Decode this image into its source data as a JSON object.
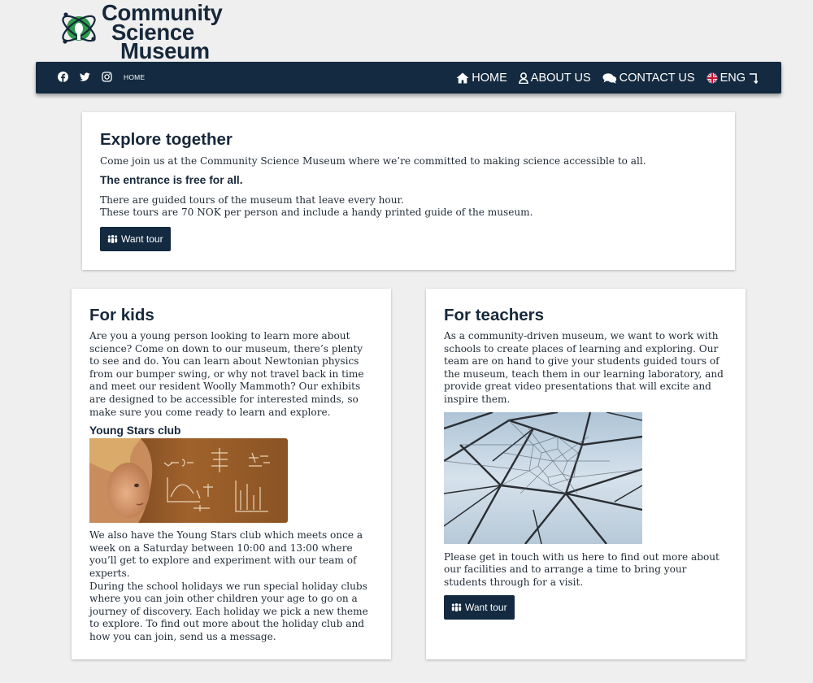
{
  "logo": {
    "line1": "Community",
    "line2": "Science",
    "line3": "Museum"
  },
  "navbar": {
    "social": [
      "facebook-icon",
      "twitter-icon",
      "instagram-icon"
    ],
    "small_home": "HOME",
    "menu": {
      "home": "HOME",
      "about": "ABOUT US",
      "contact": "CONTACT US",
      "lang": "ENG"
    }
  },
  "explore": {
    "title": "Explore together",
    "intro": "Come join us at the Community Science Museum where we’re committed to making science accessible to all.",
    "subtitle": "The entrance is free for all.",
    "tours_line1": "There are guided tours of the museum that leave every hour.",
    "tours_line2": "These tours are 70 NOK per person and include a handy printed guide of the museum.",
    "button": "Want tour"
  },
  "kids": {
    "title": "For kids",
    "body": "Are you a young person looking to learn more about science? Come on down to our museum, there’s plenty to see and do. You can learn about Newtonian physics from our bumper swing, or why not travel back in time and meet our resident Woolly Mammoth? Our exhibits are designed to be accessible for interested minds, so make sure you come ready to learn and explore.",
    "club_title": "Young Stars club",
    "club_body1": "We also have the Young Stars club which meets once a week on a Saturday between 10:00 and 13:00 where you’ll get to explore and experiment with our team of experts.",
    "club_body2": "During the school holidays we run special holiday clubs where you can join other children your age to go on a journey of discovery. Each holiday we pick a new theme to explore. To find out more about the holiday club and how you can join, send us a message."
  },
  "teachers": {
    "title": "For teachers",
    "body": "As a community-driven museum, we want to work with schools to create places of learning and exploring. Our team are on hand to give your students guided tours of the museum, teach them in our learning laboratory, and provide great video presentations that will excite and inspire them.",
    "contact_text": "Please get in touch with us here to find out more about our facilities and to arrange a time to bring your students through for a visit.",
    "button": "Want tour"
  },
  "colors": {
    "navy": "#132a40",
    "background": "#efeff0",
    "logo_green": "#2e9a4a"
  }
}
